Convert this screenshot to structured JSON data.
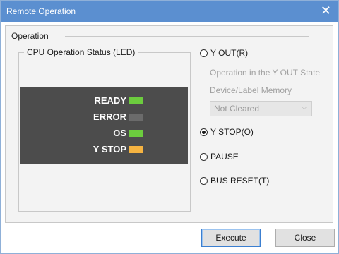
{
  "window": {
    "title": "Remote Operation",
    "close_glyph": "✕"
  },
  "operation": {
    "label": "Operation"
  },
  "cpu_status": {
    "title": "CPU Operation Status (LED)",
    "leds": [
      {
        "label": "READY",
        "color": "#6ccc3e",
        "state": "green"
      },
      {
        "label": "ERROR",
        "color": "#6b6b6b",
        "state": "off"
      },
      {
        "label": "OS",
        "color": "#6ccc3e",
        "state": "green"
      },
      {
        "label": "Y STOP",
        "color": "#f5b341",
        "state": "orange"
      }
    ]
  },
  "options": {
    "y_out": {
      "label": "Y OUT(R)",
      "checked": false
    },
    "y_out_state_label": "Operation in the Y OUT State",
    "device_label": "Device/Label Memory",
    "device_select_value": "Not Cleared",
    "y_stop": {
      "label": "Y STOP(O)",
      "checked": true
    },
    "pause": {
      "label": "PAUSE",
      "checked": false
    },
    "bus_reset": {
      "label": "BUS RESET(T)",
      "checked": false
    }
  },
  "buttons": {
    "execute": "Execute",
    "close": "Close"
  }
}
